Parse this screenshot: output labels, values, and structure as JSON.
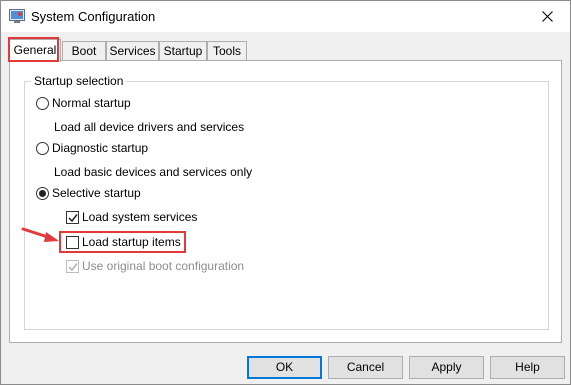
{
  "window": {
    "title": "System Configuration"
  },
  "tabs": [
    {
      "label": "General",
      "active": true
    },
    {
      "label": "Boot",
      "active": false
    },
    {
      "label": "Services",
      "active": false
    },
    {
      "label": "Startup",
      "active": false
    },
    {
      "label": "Tools",
      "active": false
    }
  ],
  "startup_selection": {
    "group_label": "Startup selection",
    "normal": {
      "label": "Normal startup",
      "description": "Load all device drivers and services",
      "selected": false
    },
    "diagnostic": {
      "label": "Diagnostic startup",
      "description": "Load basic devices and services only",
      "selected": false
    },
    "selective": {
      "label": "Selective startup",
      "selected": true,
      "options": [
        {
          "label": "Load system services",
          "checked": true,
          "enabled": true
        },
        {
          "label": "Load startup items",
          "checked": false,
          "enabled": true
        },
        {
          "label": "Use original boot configuration",
          "checked": true,
          "enabled": false
        }
      ]
    }
  },
  "buttons": {
    "ok": "OK",
    "cancel": "Cancel",
    "apply": "Apply",
    "help": "Help"
  },
  "colors": {
    "highlight": "#e03a3a",
    "default_button_border": "#0078d7"
  },
  "icons": {
    "app": "msconfig-icon",
    "close": "close-icon",
    "annotation": "red-arrow-icon"
  }
}
